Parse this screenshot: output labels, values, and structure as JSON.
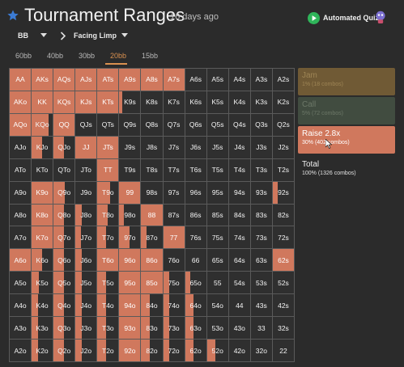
{
  "header": {
    "title": "Tournament Ranges",
    "subtitle": "16 days ago",
    "quiz_label": "Automated Quiz",
    "accent_color": "#3b7bd4",
    "play_color": "#2fb55a"
  },
  "filters": {
    "position": "BB",
    "situation": "Facing Limp"
  },
  "tabs": [
    {
      "label": "60bb",
      "active": false
    },
    {
      "label": "40bb",
      "active": false
    },
    {
      "label": "30bb",
      "active": false
    },
    {
      "label": "20bb",
      "active": true
    },
    {
      "label": "15bb",
      "active": false
    }
  ],
  "actions": {
    "jam": {
      "label": "Jam",
      "sub": "1% (18 combos)",
      "color": "#705a35"
    },
    "call": {
      "label": "Call",
      "sub": "5% (72 combos)",
      "color": "#414c40"
    },
    "raise": {
      "label": "Raise 2.8x",
      "sub": "30% (402 combos)",
      "color": "#d0785d"
    }
  },
  "total": {
    "label": "Total",
    "sub": "100% (1326 combos)"
  },
  "colors": {
    "raise": "#d0785d",
    "cell_bg": "#2f2f2f",
    "grid_line": "#5a5a5a"
  },
  "grid": {
    "rows": [
      [
        "AA",
        "AKs",
        "AQs",
        "AJs",
        "ATs",
        "A9s",
        "A8s",
        "A7s",
        "A6s",
        "A5s",
        "A4s",
        "A3s",
        "A2s"
      ],
      [
        "AKo",
        "KK",
        "KQs",
        "KJs",
        "KTs",
        "K9s",
        "K8s",
        "K7s",
        "K6s",
        "K5s",
        "K4s",
        "K3s",
        "K2s"
      ],
      [
        "AQo",
        "KQo",
        "QQ",
        "QJs",
        "QTs",
        "Q9s",
        "Q8s",
        "Q7s",
        "Q6s",
        "Q5s",
        "Q4s",
        "Q3s",
        "Q2s"
      ],
      [
        "AJo",
        "KJo",
        "QJo",
        "JJ",
        "JTs",
        "J9s",
        "J8s",
        "J7s",
        "J6s",
        "J5s",
        "J4s",
        "J3s",
        "J2s"
      ],
      [
        "ATo",
        "KTo",
        "QTo",
        "JTo",
        "TT",
        "T9s",
        "T8s",
        "T7s",
        "T6s",
        "T5s",
        "T4s",
        "T3s",
        "T2s"
      ],
      [
        "A9o",
        "K9o",
        "Q9o",
        "J9o",
        "T9o",
        "99",
        "98s",
        "97s",
        "96s",
        "95s",
        "94s",
        "93s",
        "92s"
      ],
      [
        "A8o",
        "K8o",
        "Q8o",
        "J8o",
        "T8o",
        "98o",
        "88",
        "87s",
        "86s",
        "85s",
        "84s",
        "83s",
        "82s"
      ],
      [
        "A7o",
        "K7o",
        "Q7o",
        "J7o",
        "T7o",
        "97o",
        "87o",
        "77",
        "76s",
        "75s",
        "74s",
        "73s",
        "72s"
      ],
      [
        "A6o",
        "K6o",
        "Q6o",
        "J6o",
        "T6o",
        "96o",
        "86o",
        "76o",
        "66",
        "65s",
        "64s",
        "63s",
        "62s"
      ],
      [
        "A5o",
        "K5o",
        "Q5o",
        "J5o",
        "T5o",
        "95o",
        "85o",
        "75o",
        "65o",
        "55",
        "54s",
        "53s",
        "52s"
      ],
      [
        "A4o",
        "K4o",
        "Q4o",
        "J4o",
        "T4o",
        "94o",
        "84o",
        "74o",
        "64o",
        "54o",
        "44",
        "43s",
        "42s"
      ],
      [
        "A3o",
        "K3o",
        "Q3o",
        "J3o",
        "T3o",
        "93o",
        "83o",
        "73o",
        "63o",
        "53o",
        "43o",
        "33",
        "32s"
      ],
      [
        "A2o",
        "K2o",
        "Q2o",
        "J2o",
        "T2o",
        "92o",
        "82o",
        "72o",
        "62o",
        "52o",
        "42o",
        "32o",
        "22"
      ]
    ],
    "raise_freq": [
      [
        1,
        1,
        1,
        1,
        1,
        1,
        1,
        1,
        0,
        0,
        0,
        0,
        0
      ],
      [
        1,
        1,
        1,
        1,
        1,
        0.12,
        0,
        0,
        0,
        0,
        0,
        0,
        0
      ],
      [
        1,
        0.8,
        1,
        0,
        0,
        0,
        0,
        0,
        0,
        0,
        0,
        0,
        0
      ],
      [
        0,
        0.5,
        0.5,
        1,
        1,
        0,
        0,
        0,
        0,
        0,
        0,
        0,
        0
      ],
      [
        0,
        0,
        0,
        0,
        1,
        0,
        0,
        0,
        0,
        0,
        0,
        0,
        0
      ],
      [
        0,
        1,
        0.55,
        0,
        0.6,
        1,
        0,
        0,
        0,
        0,
        0,
        0,
        0.25
      ],
      [
        0,
        1,
        0.5,
        0.3,
        0.5,
        0.2,
        1,
        0,
        0,
        0,
        0,
        0,
        0
      ],
      [
        0,
        1,
        0.5,
        0.25,
        0.4,
        0.5,
        0.25,
        1,
        0,
        0,
        0,
        0,
        0
      ],
      [
        1,
        0.5,
        0.5,
        0.3,
        1,
        1,
        1,
        0,
        0,
        0,
        0,
        0,
        1
      ],
      [
        0,
        0.35,
        0.5,
        0.3,
        0.4,
        1,
        1,
        0.3,
        0.25,
        0,
        0,
        0,
        0
      ],
      [
        0,
        0.3,
        0.5,
        0.3,
        0.4,
        1,
        0.4,
        0.3,
        0.4,
        0,
        0,
        0,
        0
      ],
      [
        0,
        0.3,
        0.5,
        0.3,
        0.4,
        1,
        0.4,
        0.3,
        0.4,
        0,
        0,
        0,
        0
      ],
      [
        0,
        0.3,
        0.5,
        0.3,
        0.4,
        1,
        0.4,
        0.3,
        0.4,
        0.4,
        0,
        0,
        0
      ]
    ]
  }
}
